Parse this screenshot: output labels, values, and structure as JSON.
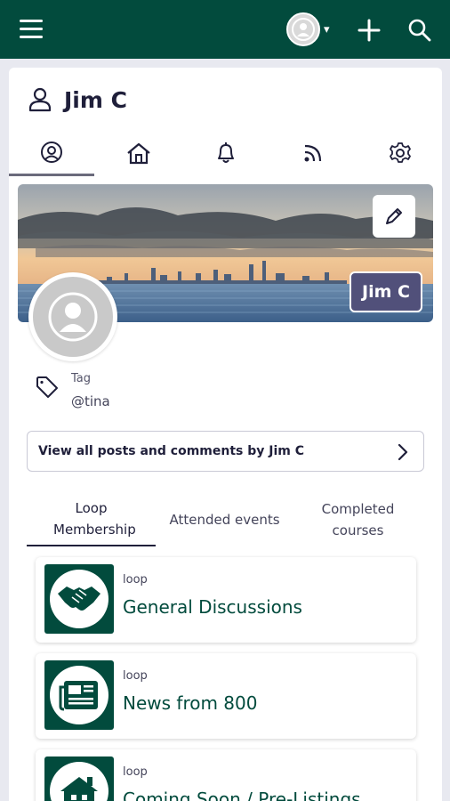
{
  "header": {
    "menu_icon": "hamburger-menu-icon",
    "avatar_icon": "user-avatar-icon",
    "caret": "▾",
    "add_icon": "plus-icon",
    "search_icon": "search-icon",
    "bar_color": "#024b3d"
  },
  "profile": {
    "name": "Jim C",
    "badge_name": "Jim C",
    "tag_label": "Tag",
    "tag_value": "@tina",
    "posts_link": "View all posts and comments by Jim C"
  },
  "profile_tabs": [
    {
      "icon": "user-circle-icon",
      "active": true
    },
    {
      "icon": "home-icon",
      "active": false
    },
    {
      "icon": "bell-icon",
      "active": false
    },
    {
      "icon": "rss-icon",
      "active": false
    },
    {
      "icon": "gear-icon",
      "active": false
    }
  ],
  "sub_tabs": [
    {
      "label": "Loop Membership",
      "active": true
    },
    {
      "label": "Attended events",
      "active": false
    },
    {
      "label": "Completed courses",
      "active": false
    }
  ],
  "loops": [
    {
      "type": "loop",
      "name": "General Discussions",
      "icon": "handshake-icon"
    },
    {
      "type": "loop",
      "name": "News from 800",
      "icon": "newspaper-icon"
    },
    {
      "type": "loop",
      "name": "Coming Soon / Pre-Listings",
      "icon": "house-icon"
    }
  ]
}
